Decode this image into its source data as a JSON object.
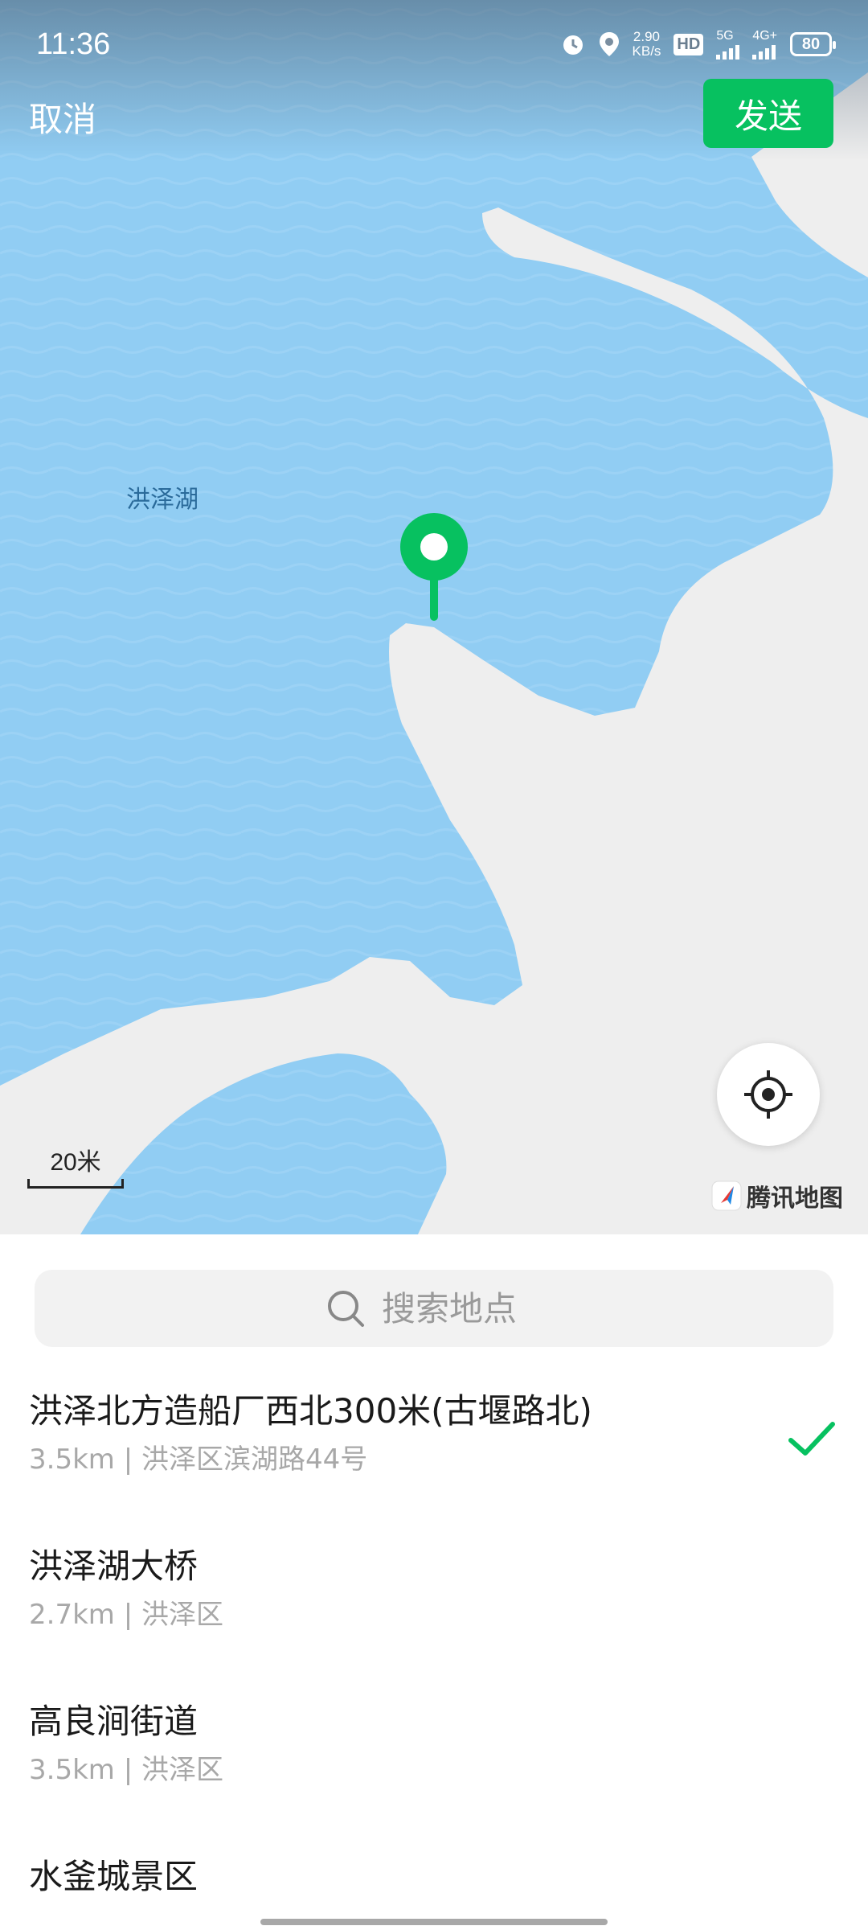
{
  "status_bar": {
    "time": "11:36",
    "net_speed_value": "2.90",
    "net_speed_unit": "KB/s",
    "hd_label": "HD",
    "sim1_tech": "5G",
    "sim2_tech": "4G+",
    "battery": "80"
  },
  "header": {
    "cancel_label": "取消",
    "send_label": "发送",
    "accent_color": "#07c160"
  },
  "map": {
    "lake_label": "洪泽湖",
    "scale_label": "20米",
    "brand_label": "腾讯地图"
  },
  "search": {
    "placeholder": "搜索地点"
  },
  "locations": [
    {
      "name": "洪泽北方造船厂西北300米(古堰路北)",
      "detail": "3.5km | 洪泽区滨湖路44号",
      "selected": true
    },
    {
      "name": "洪泽湖大桥",
      "detail": "2.7km | 洪泽区",
      "selected": false
    },
    {
      "name": "高良涧街道",
      "detail": "3.5km | 洪泽区",
      "selected": false
    },
    {
      "name": "水釜城景区",
      "detail": "",
      "selected": false
    }
  ]
}
